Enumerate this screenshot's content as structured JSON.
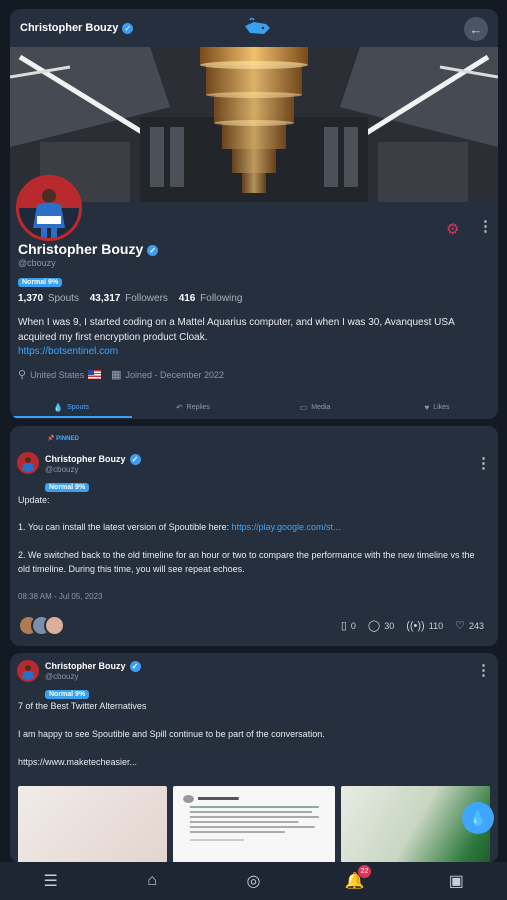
{
  "header": {
    "name": "Christopher Bouzy",
    "back_icon": "arrow-left-icon",
    "logo_icon": "spoutible-logo-icon"
  },
  "profile": {
    "name": "Christopher Bouzy",
    "handle": "@cbouzy",
    "badge": "Normal 9%",
    "stats": {
      "spouts_count": "1,370",
      "spouts_label": "Spouts",
      "followers_count": "43,317",
      "followers_label": "Followers",
      "following_count": "416",
      "following_label": "Following"
    },
    "bio": "When I was 9, I started coding on a Mattel Aquarius computer, and when I was 30, Avanquest USA acquired my first encryption product Cloak.",
    "website": "https://botsentinel.com",
    "location": "United States",
    "joined": "Joined - December 2022"
  },
  "tabs": [
    {
      "label": "Spouts",
      "icon": "droplet-icon"
    },
    {
      "label": "Replies",
      "icon": "reply-icon"
    },
    {
      "label": "Media",
      "icon": "image-icon"
    },
    {
      "label": "Likes",
      "icon": "heart-icon"
    }
  ],
  "posts": [
    {
      "pinned_label": "PINNED",
      "author": "Christopher Bouzy",
      "handle": "@cbouzy",
      "badge": "Normal 9%",
      "line1": "Update:",
      "line2_text": "1. You can install the latest version of Spoutible here: ",
      "line2_link": "https://play.google.com/st...",
      "line3": "2. We switched back to the old timeline for an hour or two to compare the performance with the new timeline vs the old timeline. During this time, you will see repeat echoes.",
      "timestamp": "08:38 AM - Jul 05, 2023",
      "counts": {
        "bookmarks": "0",
        "comments": "30",
        "echoes": "110",
        "likes": "243"
      }
    },
    {
      "author": "Christopher Bouzy",
      "handle": "@cbouzy",
      "badge": "Normal 9%",
      "line1": "7 of the Best Twitter Alternatives",
      "line2": "I am happy to see Spoutible and Spill continue to be part of the conversation.",
      "link": "https://www.maketecheasier..."
    }
  ],
  "bottom_nav": {
    "notifications_count": "22"
  },
  "colors": {
    "accent": "#3d9df5",
    "card": "#262f3e",
    "background": "#141a24",
    "alert": "#e0335a"
  }
}
